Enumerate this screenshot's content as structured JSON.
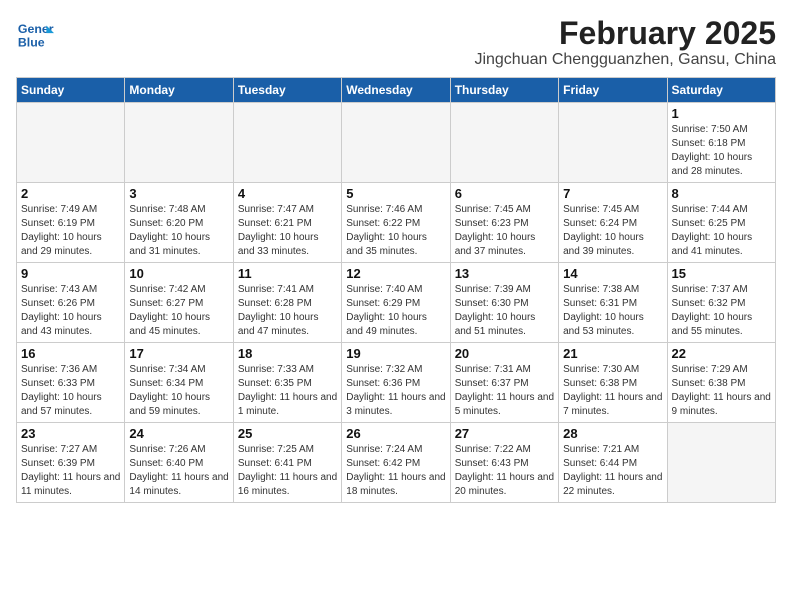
{
  "header": {
    "logo_line1": "General",
    "logo_line2": "Blue",
    "month_title": "February 2025",
    "location": "Jingchuan Chengguanzhen, Gansu, China"
  },
  "weekdays": [
    "Sunday",
    "Monday",
    "Tuesday",
    "Wednesday",
    "Thursday",
    "Friday",
    "Saturday"
  ],
  "weeks": [
    [
      {
        "day": "",
        "info": ""
      },
      {
        "day": "",
        "info": ""
      },
      {
        "day": "",
        "info": ""
      },
      {
        "day": "",
        "info": ""
      },
      {
        "day": "",
        "info": ""
      },
      {
        "day": "",
        "info": ""
      },
      {
        "day": "1",
        "info": "Sunrise: 7:50 AM\nSunset: 6:18 PM\nDaylight: 10 hours and 28 minutes."
      }
    ],
    [
      {
        "day": "2",
        "info": "Sunrise: 7:49 AM\nSunset: 6:19 PM\nDaylight: 10 hours and 29 minutes."
      },
      {
        "day": "3",
        "info": "Sunrise: 7:48 AM\nSunset: 6:20 PM\nDaylight: 10 hours and 31 minutes."
      },
      {
        "day": "4",
        "info": "Sunrise: 7:47 AM\nSunset: 6:21 PM\nDaylight: 10 hours and 33 minutes."
      },
      {
        "day": "5",
        "info": "Sunrise: 7:46 AM\nSunset: 6:22 PM\nDaylight: 10 hours and 35 minutes."
      },
      {
        "day": "6",
        "info": "Sunrise: 7:45 AM\nSunset: 6:23 PM\nDaylight: 10 hours and 37 minutes."
      },
      {
        "day": "7",
        "info": "Sunrise: 7:45 AM\nSunset: 6:24 PM\nDaylight: 10 hours and 39 minutes."
      },
      {
        "day": "8",
        "info": "Sunrise: 7:44 AM\nSunset: 6:25 PM\nDaylight: 10 hours and 41 minutes."
      }
    ],
    [
      {
        "day": "9",
        "info": "Sunrise: 7:43 AM\nSunset: 6:26 PM\nDaylight: 10 hours and 43 minutes."
      },
      {
        "day": "10",
        "info": "Sunrise: 7:42 AM\nSunset: 6:27 PM\nDaylight: 10 hours and 45 minutes."
      },
      {
        "day": "11",
        "info": "Sunrise: 7:41 AM\nSunset: 6:28 PM\nDaylight: 10 hours and 47 minutes."
      },
      {
        "day": "12",
        "info": "Sunrise: 7:40 AM\nSunset: 6:29 PM\nDaylight: 10 hours and 49 minutes."
      },
      {
        "day": "13",
        "info": "Sunrise: 7:39 AM\nSunset: 6:30 PM\nDaylight: 10 hours and 51 minutes."
      },
      {
        "day": "14",
        "info": "Sunrise: 7:38 AM\nSunset: 6:31 PM\nDaylight: 10 hours and 53 minutes."
      },
      {
        "day": "15",
        "info": "Sunrise: 7:37 AM\nSunset: 6:32 PM\nDaylight: 10 hours and 55 minutes."
      }
    ],
    [
      {
        "day": "16",
        "info": "Sunrise: 7:36 AM\nSunset: 6:33 PM\nDaylight: 10 hours and 57 minutes."
      },
      {
        "day": "17",
        "info": "Sunrise: 7:34 AM\nSunset: 6:34 PM\nDaylight: 10 hours and 59 minutes."
      },
      {
        "day": "18",
        "info": "Sunrise: 7:33 AM\nSunset: 6:35 PM\nDaylight: 11 hours and 1 minute."
      },
      {
        "day": "19",
        "info": "Sunrise: 7:32 AM\nSunset: 6:36 PM\nDaylight: 11 hours and 3 minutes."
      },
      {
        "day": "20",
        "info": "Sunrise: 7:31 AM\nSunset: 6:37 PM\nDaylight: 11 hours and 5 minutes."
      },
      {
        "day": "21",
        "info": "Sunrise: 7:30 AM\nSunset: 6:38 PM\nDaylight: 11 hours and 7 minutes."
      },
      {
        "day": "22",
        "info": "Sunrise: 7:29 AM\nSunset: 6:38 PM\nDaylight: 11 hours and 9 minutes."
      }
    ],
    [
      {
        "day": "23",
        "info": "Sunrise: 7:27 AM\nSunset: 6:39 PM\nDaylight: 11 hours and 11 minutes."
      },
      {
        "day": "24",
        "info": "Sunrise: 7:26 AM\nSunset: 6:40 PM\nDaylight: 11 hours and 14 minutes."
      },
      {
        "day": "25",
        "info": "Sunrise: 7:25 AM\nSunset: 6:41 PM\nDaylight: 11 hours and 16 minutes."
      },
      {
        "day": "26",
        "info": "Sunrise: 7:24 AM\nSunset: 6:42 PM\nDaylight: 11 hours and 18 minutes."
      },
      {
        "day": "27",
        "info": "Sunrise: 7:22 AM\nSunset: 6:43 PM\nDaylight: 11 hours and 20 minutes."
      },
      {
        "day": "28",
        "info": "Sunrise: 7:21 AM\nSunset: 6:44 PM\nDaylight: 11 hours and 22 minutes."
      },
      {
        "day": "",
        "info": ""
      }
    ]
  ]
}
